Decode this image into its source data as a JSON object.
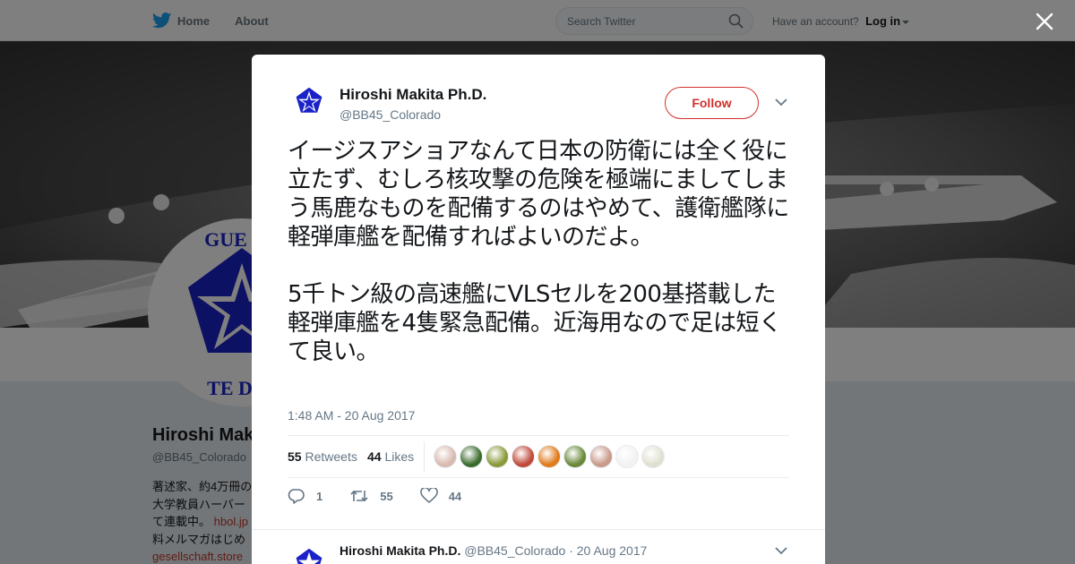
{
  "nav": {
    "home_label": "Home",
    "about_label": "About",
    "search_placeholder": "Search Twitter",
    "account_prompt": "Have an account?",
    "login_label": "Log in"
  },
  "profile": {
    "name": "Hiroshi Makita Ph.D.",
    "handle": "@BB45_Colorado",
    "bio_text": "著述家、約4万冊の 大学教員ハーバー て連載中。",
    "bio_link1": "hbol.jp",
    "bio_text2": "料メルマガはじめ",
    "bio_link2": "gesellschaft.store",
    "avatar_logo_text_top": "GUE OF",
    "avatar_logo_text_bottom": "TE DES"
  },
  "tweet": {
    "author_name": "Hiroshi Makita Ph.D.",
    "author_handle": "@BB45_Colorado",
    "follow_label": "Follow",
    "text": "イージスアショアなんて日本の防衛には全く役に立たず、むしろ核攻撃の危険を極端にましてしまう馬鹿なものを配備するのはやめて、護衛艦隊に軽弾庫艦を配備すればよいのだよ。\n\n5千トン級の高速艦にVLSセルを200基搭載した軽弾庫艦を4隻緊急配備。近海用なので足は短くて良い。",
    "timestamp": "1:48 AM - 20 Aug 2017",
    "retweets_count": "55",
    "retweets_label": "Retweets",
    "likes_count": "44",
    "likes_label": "Likes",
    "reply_count": "1",
    "retweet_action_count": "55",
    "like_action_count": "44",
    "liker_colors": [
      "#d9b9b0",
      "#3a6b2c",
      "#8a9a3a",
      "#c04a3a",
      "#e07a1a",
      "#6a8a3a",
      "#c89a8a",
      "#f2f2f2",
      "#e0e0d0"
    ]
  },
  "reply": {
    "author_name": "Hiroshi Makita Ph.D.",
    "author_handle": "@BB45_Colorado",
    "date": "· 20 Aug 2017"
  },
  "colors": {
    "twitter_blue": "#1da1f2",
    "follow_red": "#d0312d",
    "logo_blue": "#1a22c8"
  }
}
